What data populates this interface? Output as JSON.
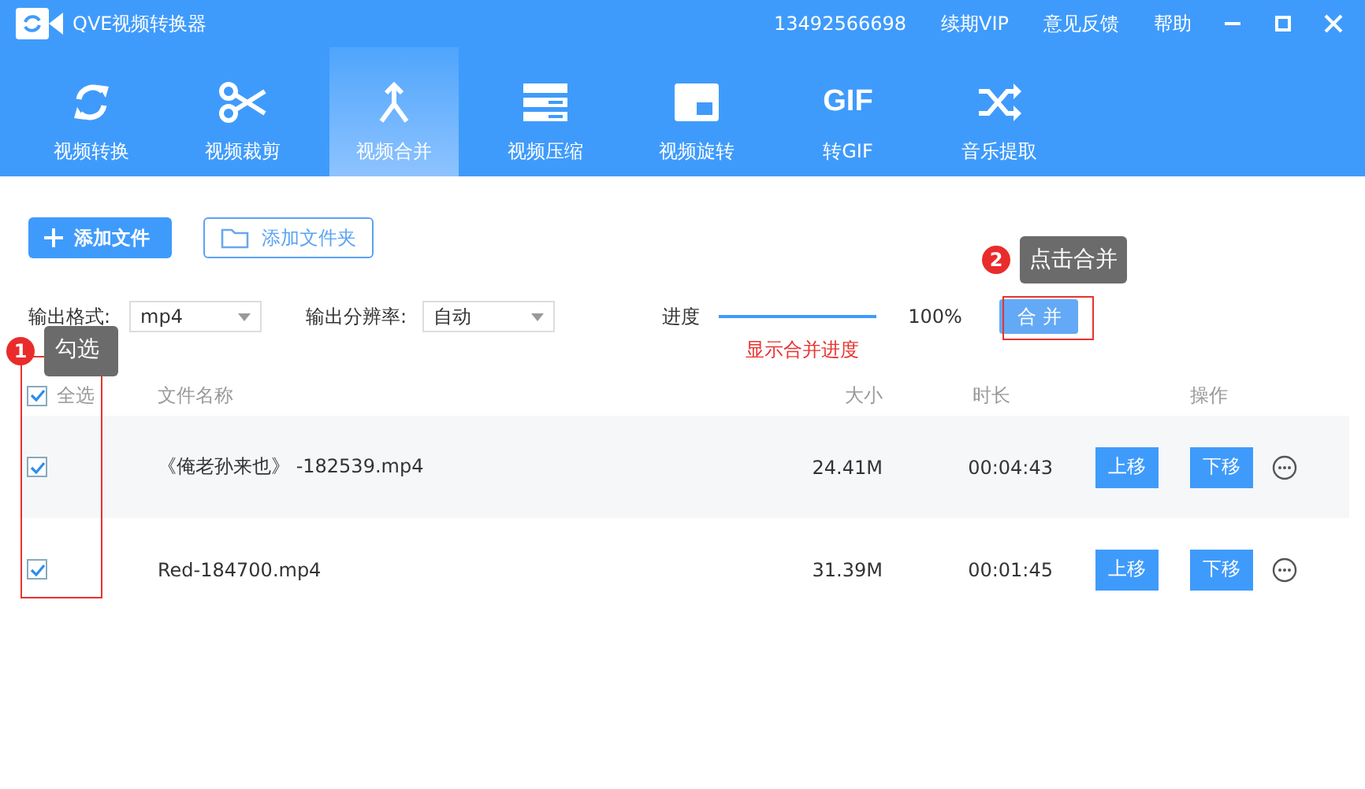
{
  "window": {
    "title": "QVE视频转换器",
    "account": "13492566698",
    "links": [
      "续期VIP",
      "意见反馈",
      "帮助"
    ]
  },
  "tabs": [
    {
      "label": "视频转换",
      "selected": false
    },
    {
      "label": "视频裁剪",
      "selected": false
    },
    {
      "label": "视频合并",
      "selected": true
    },
    {
      "label": "视频压缩",
      "selected": false
    },
    {
      "label": "视频旋转",
      "selected": false
    },
    {
      "label": "转GIF",
      "glyph": "GIF",
      "selected": false
    },
    {
      "label": "音乐提取",
      "selected": false
    }
  ],
  "toolbar": {
    "add_file": "添加文件",
    "add_folder": "添加文件夹"
  },
  "options": {
    "format_label": "输出格式:",
    "format": "mp4",
    "resolution_label": "输出分辨率:",
    "resolution": "自动",
    "progress_label": "进度",
    "level": 1,
    "progress_text": "100%",
    "merge_button": "合 并",
    "progress_note": "显示合并进度"
  },
  "callouts": [
    {
      "number": "1",
      "text": "勾选"
    },
    {
      "number": "2",
      "text": "点击合并"
    }
  ],
  "table": {
    "select_all": {
      "label": "全选",
      "checked": true
    },
    "columns": [
      "文件名称",
      "大小",
      "时长",
      "操作"
    ],
    "rows": [
      {
        "checked": true,
        "name": "《俺老孙来也》 -182539.mp4",
        "size": "24.41M",
        "duration": "00:04:43",
        "up": "上移",
        "down": "下移"
      },
      {
        "checked": true,
        "name": "Red-184700.mp4",
        "size": "31.39M",
        "duration": "00:01:45",
        "up": "上移",
        "down": "下移"
      }
    ]
  }
}
